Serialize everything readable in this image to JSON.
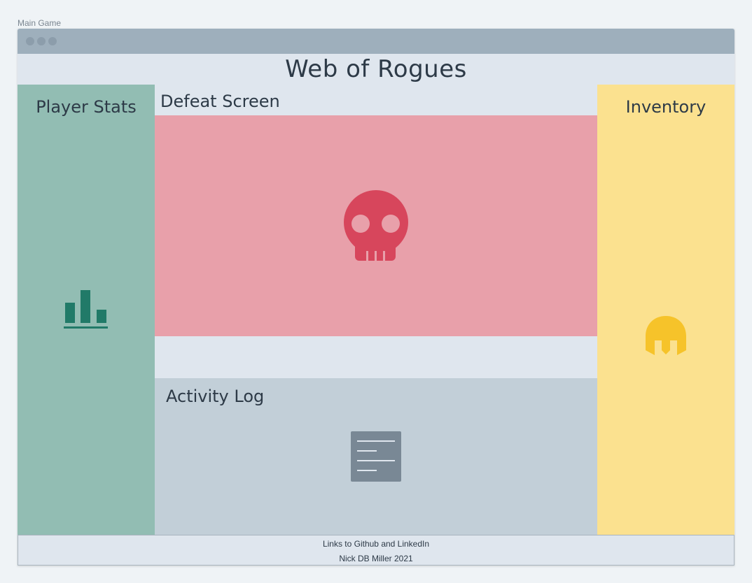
{
  "frame": {
    "label": "Main Game"
  },
  "app": {
    "title": "Web of Rogues"
  },
  "left_panel": {
    "heading": "Player Stats",
    "icon": "bar-chart-icon",
    "color": "#92bdb3",
    "icon_color": "#217a68"
  },
  "center": {
    "defeat": {
      "heading": "Defeat Screen",
      "icon": "skull-icon",
      "color": "#e8a0aa",
      "icon_color": "#d7465c"
    },
    "activity": {
      "heading": "Activity Log",
      "icon": "document-icon",
      "color": "#c2cfd8",
      "icon_color": "#798895"
    }
  },
  "right_panel": {
    "heading": "Inventory",
    "icon": "helmet-icon",
    "color": "#fbe18f",
    "icon_color": "#f6c32a"
  },
  "footer": {
    "line1": "Links to Github and LinkedIn",
    "line2": "Nick DB Miller 2021"
  }
}
